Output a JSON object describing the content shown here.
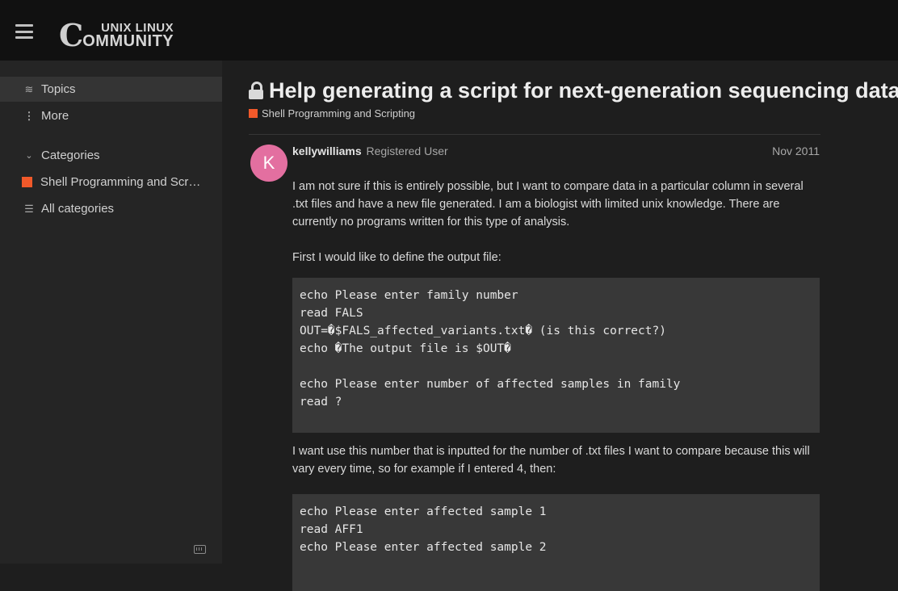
{
  "header": {
    "logo_big": "C",
    "logo_top": "UNIX LINUX",
    "logo_bottom": "OMMUNITY"
  },
  "sidebar": {
    "items": [
      {
        "label": "Topics",
        "icon": "layers-icon"
      },
      {
        "label": "More",
        "icon": "vertical-dots-icon"
      },
      {
        "label": "Categories",
        "icon": "chevron-down-icon"
      },
      {
        "label": "Shell Programming and Scr…",
        "icon": "category-square"
      },
      {
        "label": "All categories",
        "icon": "list-icon"
      }
    ],
    "category_color": "#f1592a"
  },
  "topic": {
    "title": "Help generating a script for next-generation sequencing data",
    "category": "Shell Programming and Scripting"
  },
  "post": {
    "avatar_letter": "K",
    "avatar_color": "#e36fa0",
    "username": "kellywilliams",
    "user_title": "Registered User",
    "date": "Nov 2011",
    "paragraph1": "I am not sure if this is entirely possible, but I want to compare data in a particular column in several .txt files and have a new file generated. I am a biologist with limited unix knowledge. There are currently no programs written for this type of analysis.",
    "paragraph2": "First I would like to define the output file:",
    "code1": [
      "echo Please enter family number",
      "read FALS",
      "OUT=�$FALS_affected_variants.txt� (is this correct?)",
      "echo �The output file is $OUT�",
      "",
      "echo Please enter number of affected samples in family",
      "read ?"
    ],
    "paragraph3": "I want use this number that is inputted for the number of .txt files I want to compare because this will vary every time, so for example if I entered 4, then:",
    "code2": [
      "echo Please enter affected sample 1",
      "read AFF1",
      "echo Please enter affected sample 2"
    ]
  }
}
